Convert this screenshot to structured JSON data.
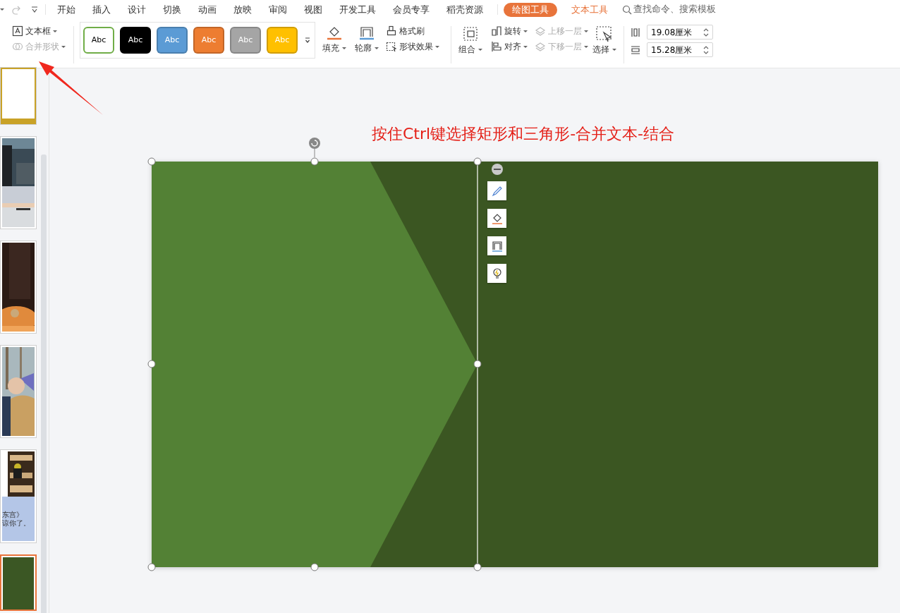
{
  "menu_tabs": [
    {
      "label": "开始",
      "kind": "main",
      "selected": false
    },
    {
      "label": "插入",
      "kind": "main",
      "selected": false
    },
    {
      "label": "设计",
      "kind": "main",
      "selected": false
    },
    {
      "label": "切换",
      "kind": "main",
      "selected": false
    },
    {
      "label": "动画",
      "kind": "main",
      "selected": false
    },
    {
      "label": "放映",
      "kind": "main",
      "selected": false
    },
    {
      "label": "审阅",
      "kind": "main",
      "selected": false
    },
    {
      "label": "视图",
      "kind": "main",
      "selected": false
    },
    {
      "label": "开发工具",
      "kind": "main",
      "selected": false
    },
    {
      "label": "会员专享",
      "kind": "main",
      "selected": false
    },
    {
      "label": "稻壳资源",
      "kind": "main",
      "selected": false
    },
    {
      "label": "绘图工具",
      "kind": "contextual",
      "selected": true
    },
    {
      "label": "文本工具",
      "kind": "contextual",
      "selected": false
    }
  ],
  "search": {
    "placeholder": "查找命令、搜索模板"
  },
  "ribbon": {
    "text_box": {
      "label": "文本框",
      "disabled": false
    },
    "merge_shapes": {
      "label": "合并形状",
      "disabled": true
    },
    "shape_styles": [
      {
        "label": "Abc",
        "kind": "outline",
        "color": "#70ad47"
      },
      {
        "label": "Abc",
        "kind": "filled",
        "color": "#000000"
      },
      {
        "label": "Abc",
        "kind": "filled",
        "color": "#5b9bd5"
      },
      {
        "label": "Abc",
        "kind": "filled",
        "color": "#ed7d31"
      },
      {
        "label": "Abc",
        "kind": "filled",
        "color": "#a5a5a5"
      },
      {
        "label": "Abc",
        "kind": "filled",
        "color": "#ffc000"
      }
    ],
    "fill": {
      "label": "填充"
    },
    "outline": {
      "label": "轮廓"
    },
    "format_painter": {
      "label": "格式刷"
    },
    "shape_effects": {
      "label": "形状效果"
    },
    "group": {
      "label": "组合"
    },
    "rotate": {
      "label": "旋转",
      "disabled": false
    },
    "align": {
      "label": "对齐",
      "disabled": false
    },
    "bring_forward": {
      "label": "上移一层",
      "disabled": true
    },
    "send_backward": {
      "label": "下移一层",
      "disabled": true
    },
    "select": {
      "label": "选择"
    },
    "width_field": {
      "value": "19.08厘米"
    },
    "height_field": {
      "value": "15.28厘米"
    }
  },
  "thumbnails": [
    {
      "kind": "blank",
      "selected": false
    },
    {
      "kind": "photos",
      "selected": false
    },
    {
      "kind": "portrait",
      "selected": false
    },
    {
      "kind": "forest",
      "selected": false
    },
    {
      "kind": "mixed",
      "selected": false,
      "texts": [
        "东宫》",
        "谅你了。"
      ]
    },
    {
      "kind": "green",
      "selected": true
    }
  ],
  "caption": "按住Ctrl键选择矩形和三角形-合并文本-结合"
}
